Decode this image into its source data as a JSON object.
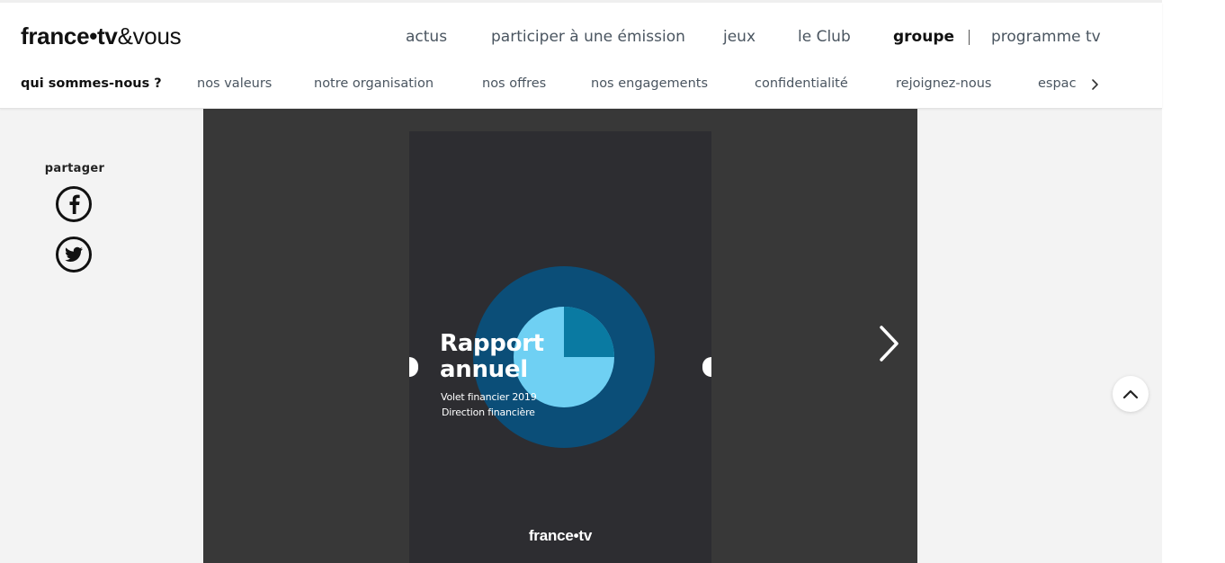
{
  "brand": {
    "logo_bold_part": "france•tv",
    "logo_rest": "&vous"
  },
  "main_nav": [
    {
      "label": "actus"
    },
    {
      "label": "participer à une émission"
    },
    {
      "label": "jeux"
    },
    {
      "label": "le Club"
    },
    {
      "label": "groupe",
      "active": true
    },
    {
      "label": "programme tv"
    }
  ],
  "sub_nav": [
    {
      "label": "qui sommes-nous ?",
      "active": true
    },
    {
      "label": "nos valeurs"
    },
    {
      "label": "notre organisation"
    },
    {
      "label": "nos offres"
    },
    {
      "label": "nos engagements"
    },
    {
      "label": "confidentialité"
    },
    {
      "label": "rejoignez-nous"
    },
    {
      "label": "espac"
    }
  ],
  "sub_nav_next_icon": "chevron-right-icon",
  "share": {
    "label": "partager",
    "buttons": [
      {
        "icon": "facebook-icon"
      },
      {
        "icon": "twitter-icon"
      }
    ]
  },
  "document": {
    "title_line1": "Rapport",
    "title_line2": "annuel",
    "subtitle_line1": "Volet financier 2019",
    "subtitle_line2": "Direction financière",
    "logo_bold_part": "france•tv",
    "colors": {
      "cover_bg": "#2d2d31",
      "outer_circle": "#0b4e78",
      "inner_circle": "#6fd0f3",
      "pie_slice": "#0a7aa2"
    }
  },
  "viewer": {
    "next_icon": "chevron-right-icon"
  },
  "scroll_top_icon": "chevron-up-icon",
  "colors": {
    "page_bg": "#f3f3f3",
    "viewer_bg": "#383838",
    "nav_text": "#4a5560"
  }
}
